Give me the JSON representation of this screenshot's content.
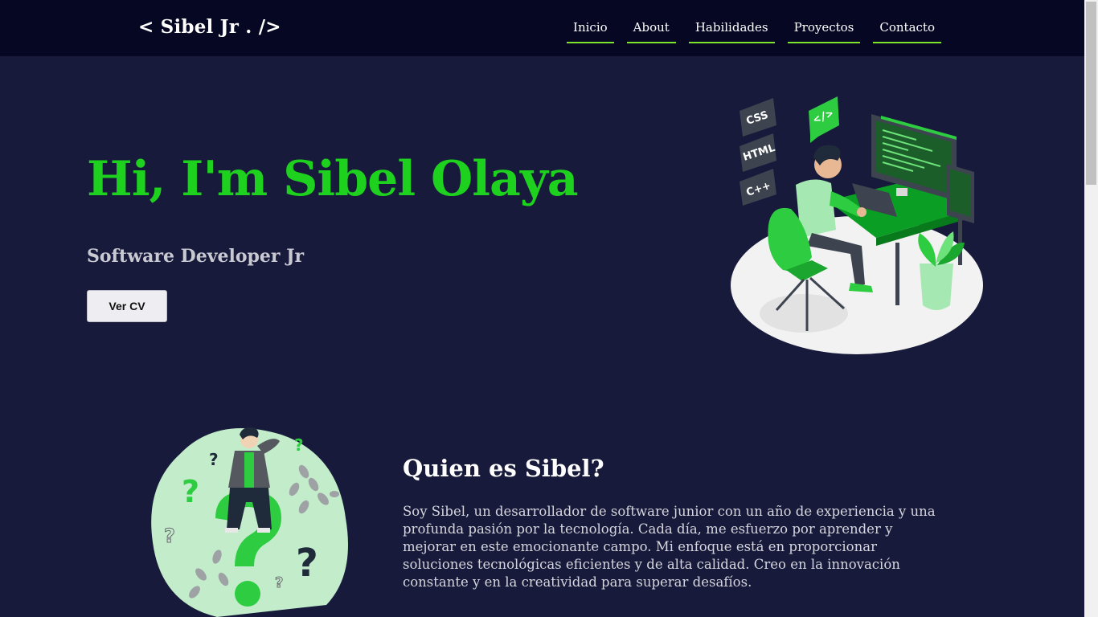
{
  "navbar": {
    "logo": "< Sibel Jr . />",
    "links": [
      "Inicio",
      "About",
      "Habilidades",
      "Proyectos",
      "Contacto"
    ]
  },
  "hero": {
    "title": "Hi, I'm Sibel Olaya",
    "subtitle": "Software Developer Jr",
    "cv_button": "Ver CV",
    "illustration_tags": [
      "CSS",
      "HTML",
      "C++",
      "</>"
    ]
  },
  "about": {
    "title": "Quien es Sibel?",
    "text": "Soy Sibel, un desarrollador de software junior con un año de experiencia y una profunda pasión por la tecnología. Cada día, me esfuerzo por aprender y mejorar en este emocionante campo. Mi enfoque está en proporcionar soluciones tecnológicas eficientes y de alta calidad. Creo en la innovación constante y en la creatividad para superar desafíos.",
    "illustration_marks": [
      "?",
      "?",
      "?",
      "?",
      "?",
      "?"
    ]
  },
  "colors": {
    "background": "#171a3a",
    "navbar": "#060723",
    "accent_green": "#1ed11e",
    "nav_underline": "#7ee32b"
  },
  "icons": {
    "hero": "developer-at-desk-illustration",
    "about": "thinking-person-question-marks-illustration"
  }
}
